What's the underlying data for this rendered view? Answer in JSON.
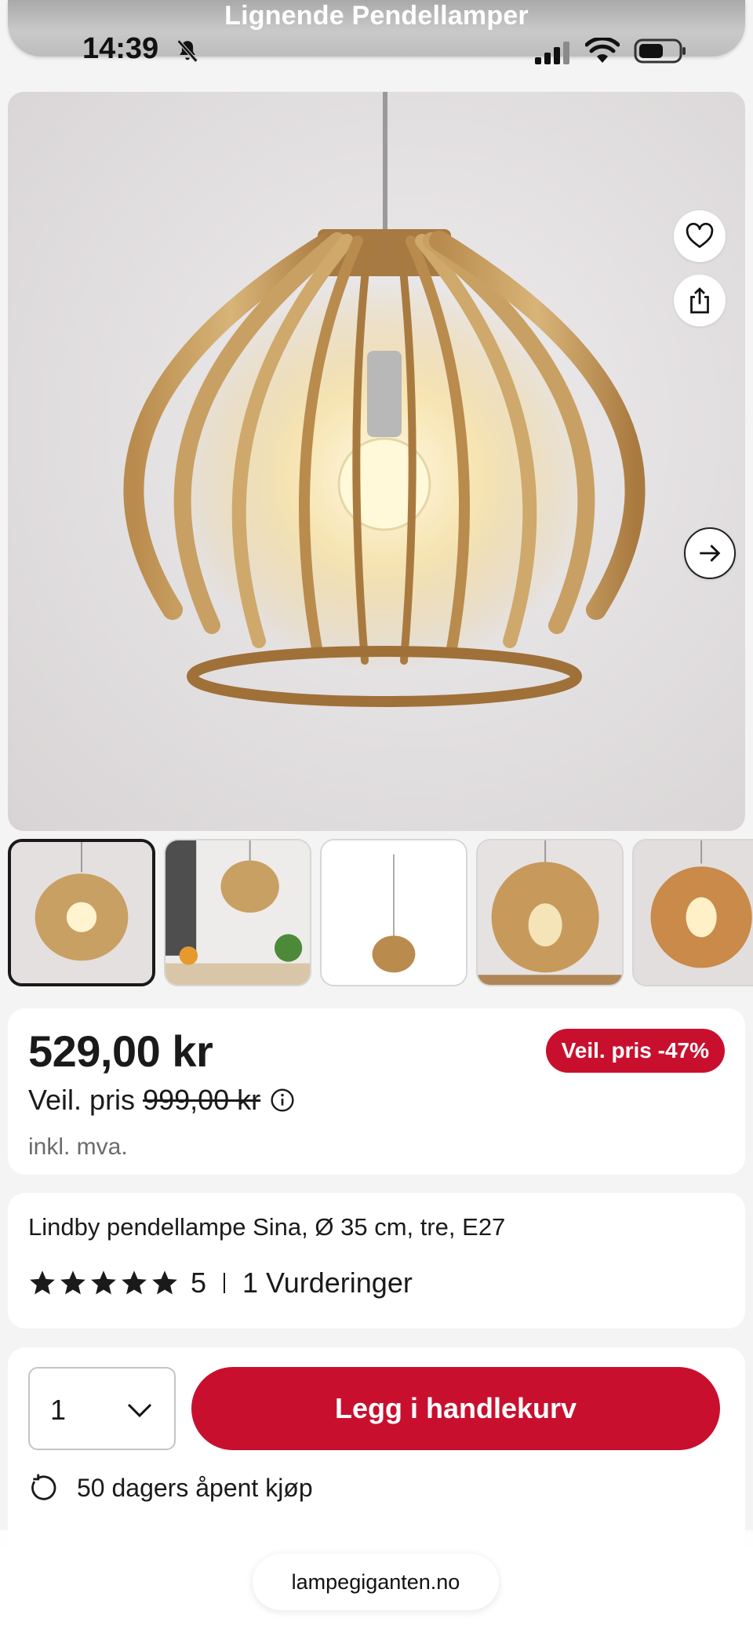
{
  "header": {
    "title": "Lignende Pendellamper"
  },
  "status_bar": {
    "time": "14:39",
    "icons": [
      "bell-slash-icon",
      "signal-icon",
      "wifi-icon",
      "battery-icon"
    ]
  },
  "gallery": {
    "actions": [
      "heart-icon",
      "share-icon",
      "arrow-right-icon"
    ],
    "thumbnail_count_visible": 5,
    "active_thumbnail": 1
  },
  "price": {
    "current": "529,00 kr",
    "rrp_label": "Veil. pris",
    "rrp_old": "999,00 kr",
    "vat_note": "inkl. mva.",
    "discount_badge": "Veil. pris -47%"
  },
  "product": {
    "title": "Lindby pendellampe Sina, Ø 35 cm, tre, E27",
    "rating": "5",
    "stars": 5,
    "reviews": "1 Vurderinger"
  },
  "purchase": {
    "quantity": "1",
    "add_to_cart_label": "Legg i handlekurv",
    "return_policy": "50 dagers åpent kjøp"
  },
  "browser": {
    "url": "lampegiganten.no"
  },
  "colors": {
    "accent": "#c8102e",
    "wood": "#c9a063",
    "background": "#f4f4f4"
  }
}
